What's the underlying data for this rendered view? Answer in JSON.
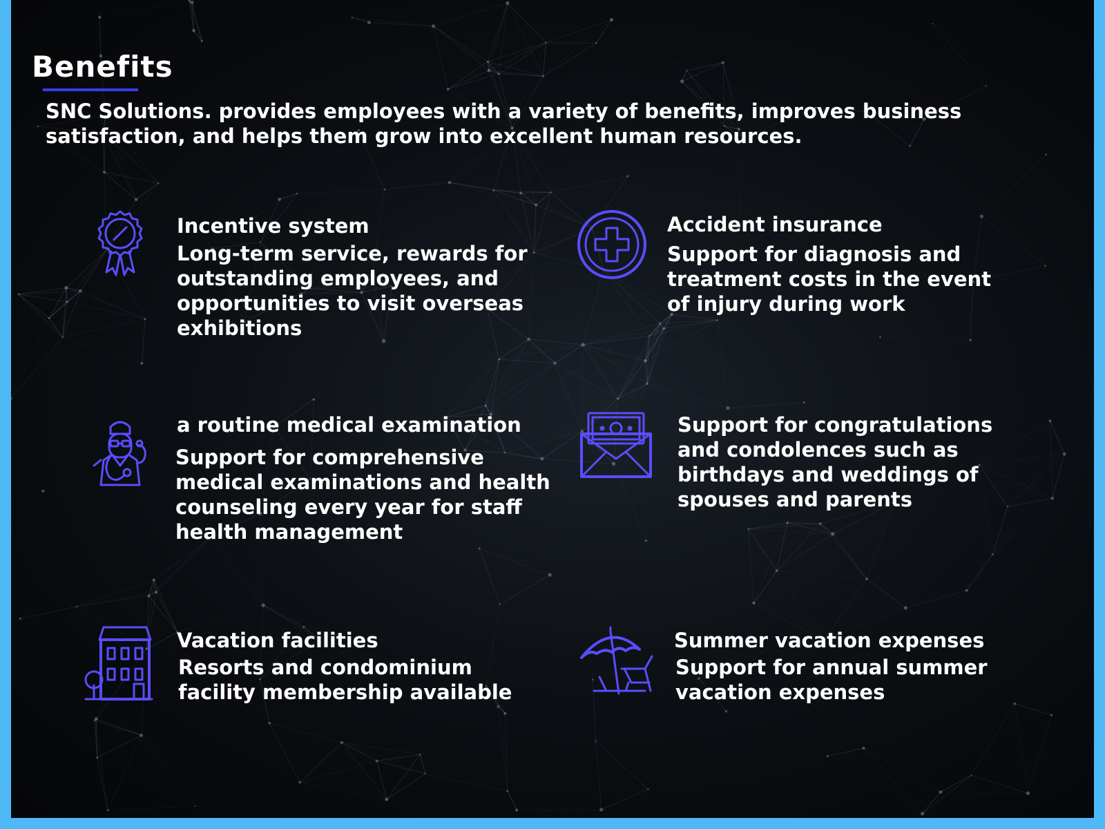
{
  "page": {
    "title": "Benefits",
    "intro": "SNC Solutions. provides employees with a variety of benefits, improves business satisfaction, and helps them grow into excellent human resources."
  },
  "colors": {
    "frame_border": "#4fb8f7",
    "background": "#0b0e12",
    "accent": "#3a3af0",
    "icon_stroke": "#5a4dff",
    "text": "#ffffff"
  },
  "benefits": [
    {
      "icon": "award-ribbon-icon",
      "heading": "Incentive system",
      "description": "Long-term service, rewards for outstanding employees, and opportunities to visit overseas exhibitions"
    },
    {
      "icon": "medical-cross-icon",
      "heading": "Accident insurance",
      "description": "Support for diagnosis and treatment costs in the event of injury during work"
    },
    {
      "icon": "doctor-stethoscope-icon",
      "heading": "a routine medical examination",
      "description": "Support for comprehensive medical examinations and health counseling every year for staff health management"
    },
    {
      "icon": "money-envelope-icon",
      "heading": "",
      "description": "Support for congratulations and condolences such as birthdays and weddings of spouses and parents"
    },
    {
      "icon": "resort-building-icon",
      "heading": "Vacation facilities",
      "description": "Resorts and condominium facility membership available"
    },
    {
      "icon": "beach-umbrella-icon",
      "heading": "Summer vacation expenses",
      "description": "Support for annual summer vacation expenses"
    }
  ]
}
